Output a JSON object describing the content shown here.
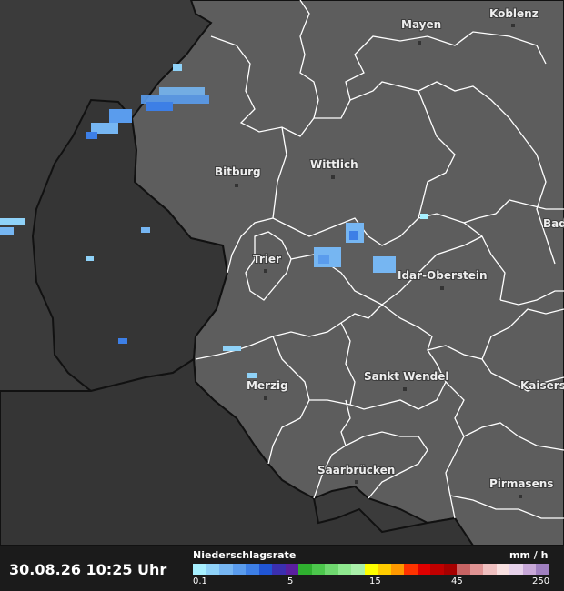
{
  "timestamp": "30.08.26 10:25 Uhr",
  "legend": {
    "title": "Niederschlagsrate",
    "unit": "mm / h",
    "ticks": [
      "0.1",
      "5",
      "15",
      "45",
      "250"
    ],
    "colors": [
      "#a7f0ff",
      "#8fd2f8",
      "#76b6f2",
      "#5a9ced",
      "#3d7fe6",
      "#2055d4",
      "#3b2fb0",
      "#5a1f9e",
      "#2fb02f",
      "#4cc74c",
      "#6fd86f",
      "#8fe88f",
      "#aaf0aa",
      "#ffff00",
      "#ffcc00",
      "#ff9900",
      "#ff3300",
      "#e00000",
      "#c00000",
      "#a60000",
      "#c86464",
      "#e09494",
      "#f0c0c0",
      "#f8e0e0",
      "#e6d2ea",
      "#c8a8d8",
      "#a080c0"
    ]
  },
  "cities": [
    {
      "name": "Mayen"
    },
    {
      "name": "Koblenz"
    },
    {
      "name": "Bitburg"
    },
    {
      "name": "Wittlich"
    },
    {
      "name": "Bad"
    },
    {
      "name": "Trier"
    },
    {
      "name": "Idar-Oberstein"
    },
    {
      "name": "Merzig"
    },
    {
      "name": "Sankt Wendel"
    },
    {
      "name": "Kaisers"
    },
    {
      "name": "Saarbrücken"
    },
    {
      "name": "Pirmasens"
    }
  ]
}
